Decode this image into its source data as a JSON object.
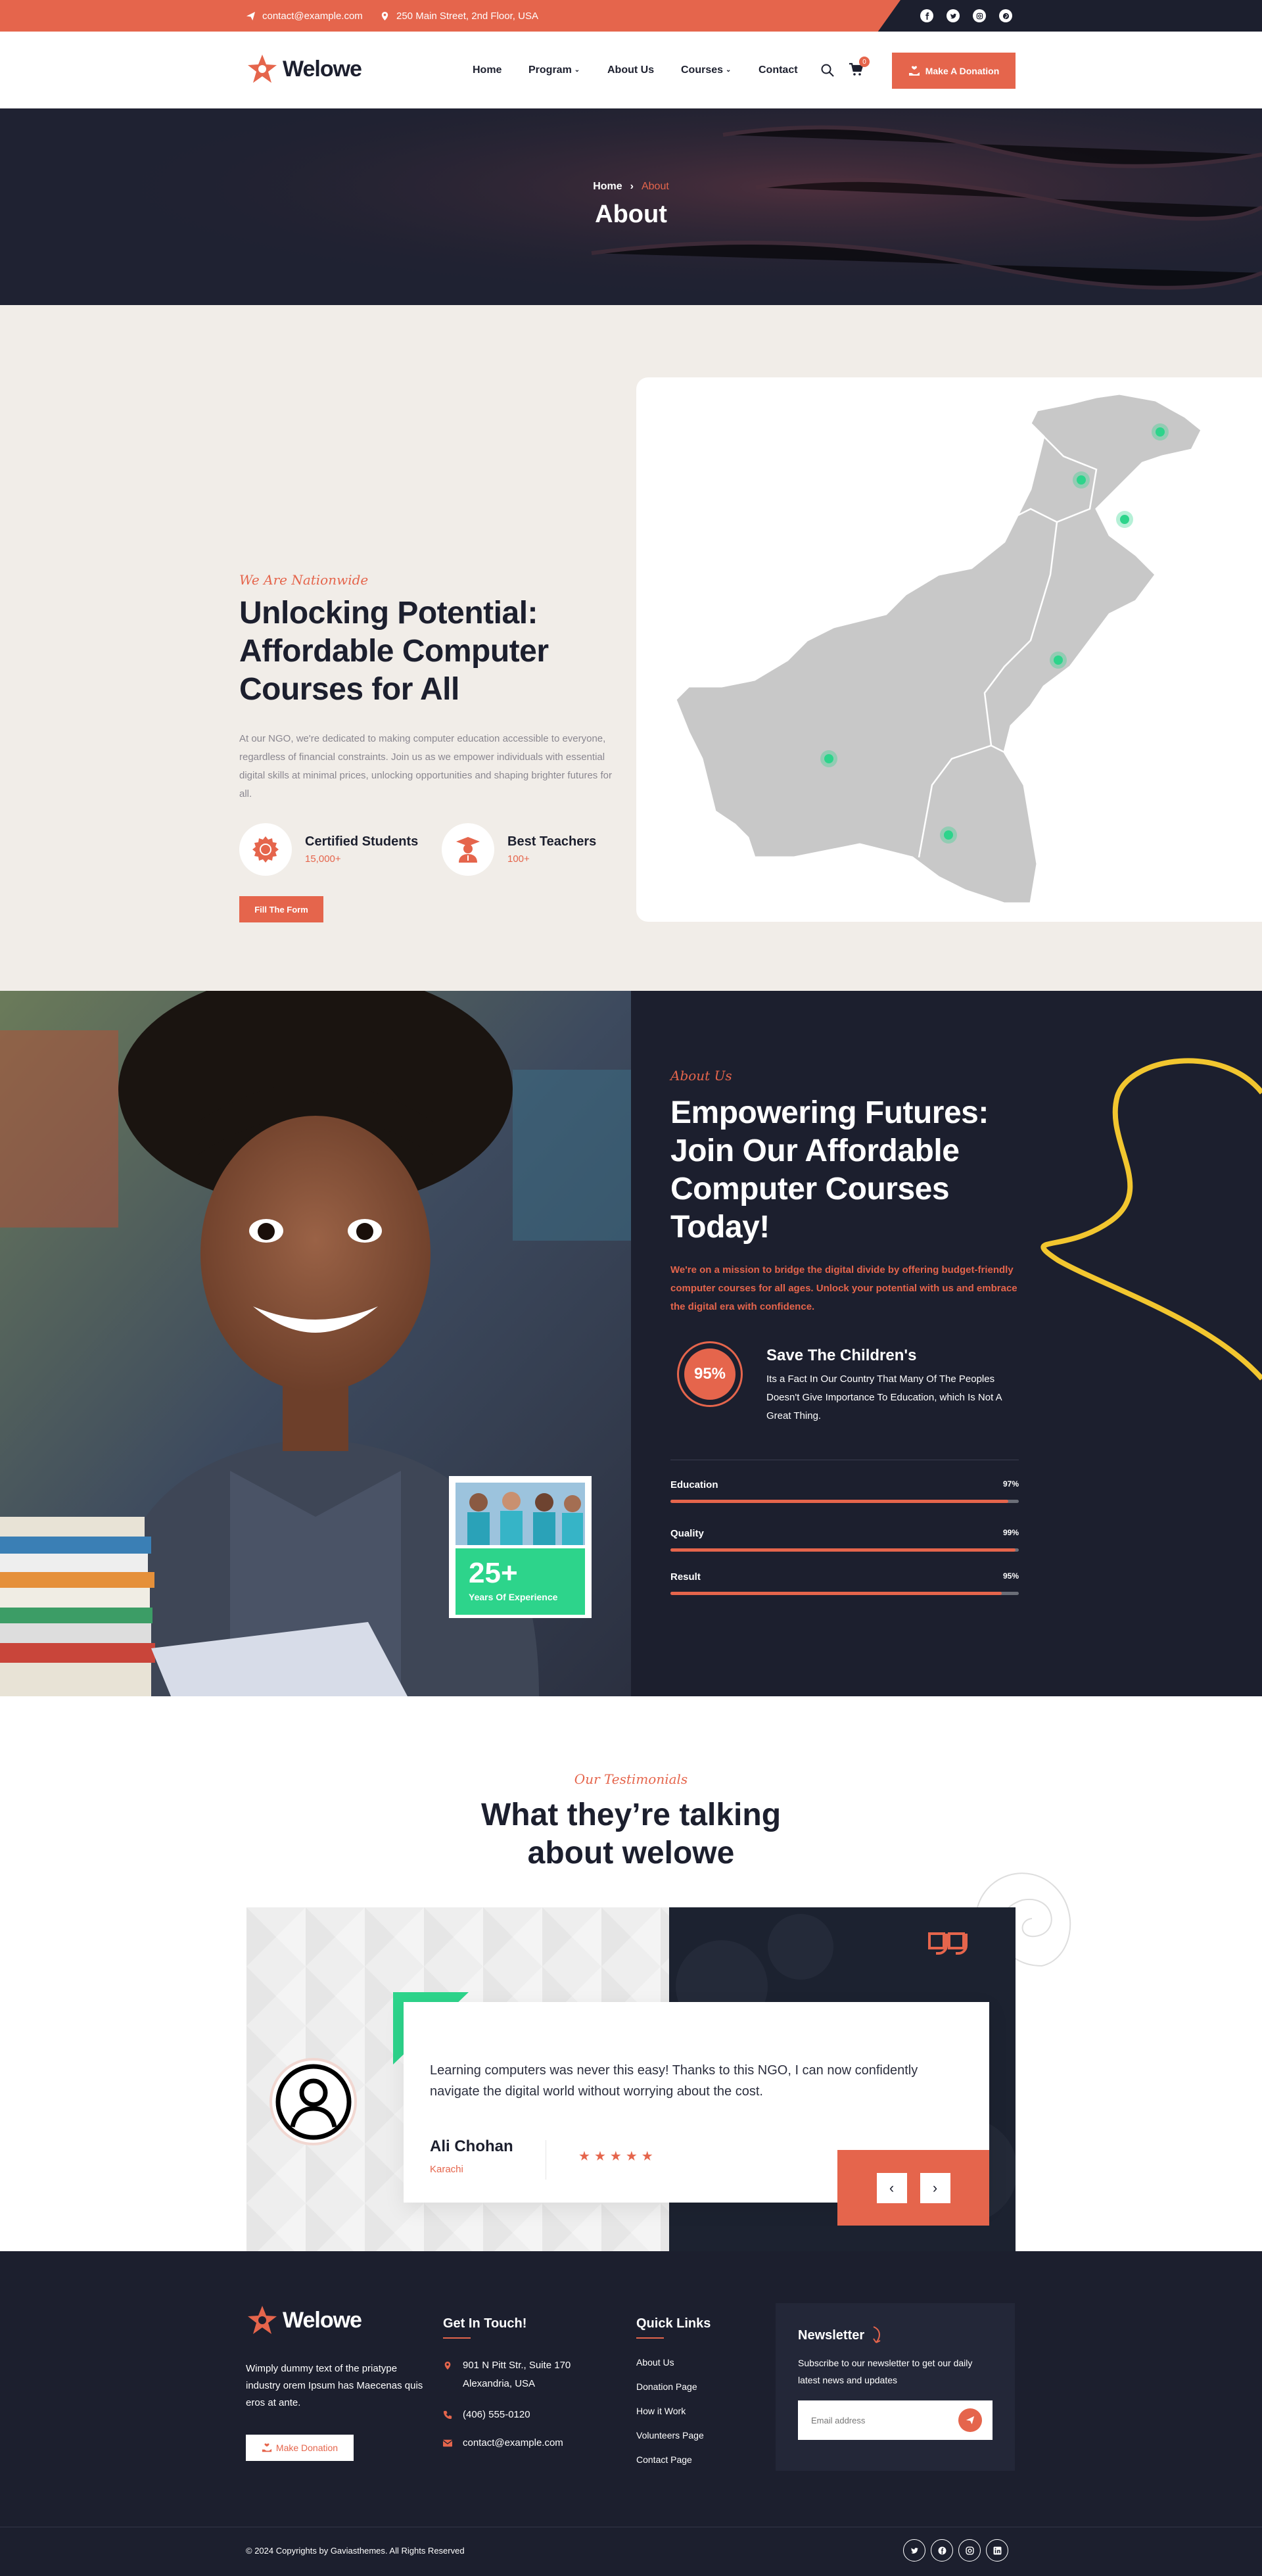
{
  "topbar": {
    "email": "contact@example.com",
    "address": "250 Main Street, 2nd Floor, USA",
    "social": [
      "facebook-icon",
      "twitter-icon",
      "instagram-icon",
      "pinterest-icon"
    ]
  },
  "header": {
    "logo": "Welowe",
    "nav": [
      "Home",
      "Program",
      "About Us",
      "Courses",
      "Contact"
    ],
    "cart_count": "0",
    "donate": "Make A Donation"
  },
  "hero": {
    "breadcrumb_home": "Home",
    "breadcrumb_current": "About",
    "title": "About"
  },
  "intro": {
    "tagline": "We Are Nationwide",
    "title": "Unlocking Potential: Affordable Computer Courses for All",
    "body": "At our NGO, we're dedicated to making computer education accessible to everyone, regardless of financial constraints. Join us as we empower individuals with essential digital skills at minimal prices, unlocking opportunities and shaping brighter futures for all.",
    "stats": [
      {
        "label": "Certified Students",
        "value": "15,000+"
      },
      {
        "label": "Best Teachers",
        "value": "100+"
      }
    ],
    "cta": "Fill The Form"
  },
  "about": {
    "tagline": "About Us",
    "title": "Empowering Futures: Join Our Affordable Computer Courses Today!",
    "lead": "We're on a mission to bridge the digital divide by offering budget-friendly computer courses for all ages. Unlock your potential with us and embrace the digital era with confidence.",
    "circle_value": "95%",
    "circle_title": "Save The Children's",
    "circle_text": "Its a Fact In Our Country That Many Of The Peoples Doesn't Give Importance To Education, which Is Not A Great Thing.",
    "experience_number": "25+",
    "experience_label": "Years Of Experience",
    "bars": [
      {
        "label": "Education",
        "value": "97%",
        "fraction": 0.97
      },
      {
        "label": "Quality",
        "value": "99%",
        "fraction": 0.99
      },
      {
        "label": "Result",
        "value": "95%",
        "fraction": 0.95
      }
    ]
  },
  "testimonials": {
    "tagline": "Our Testimonials",
    "title_line1": "What they’re talking",
    "title_line2": "about welowe",
    "quote": "Learning computers was never this easy! Thanks to this NGO, I can now confidently navigate the digital world without worrying about the cost.",
    "name": "Ali Chohan",
    "city": "Karachi",
    "stars": 5
  },
  "footer": {
    "logo": "Welowe",
    "about": "Wimply dummy text of the priatype industry orem Ipsum has Maecenas quis eros at ante.",
    "donate": "Make Donation",
    "contact_heading": "Get In Touch!",
    "address": "901 N Pitt Str., Suite 170 Alexandria, USA",
    "phone": "(406) 555-0120",
    "email": "contact@example.com",
    "links_heading": "Quick Links",
    "links": [
      "About Us",
      "Donation Page",
      "How it Work",
      "Volunteers Page",
      "Contact Page"
    ],
    "newsletter_heading": "Newsletter",
    "newsletter_text": "Subscribe to our newsletter to get our daily latest news and updates",
    "newsletter_placeholder": "Email address",
    "copyright": "© 2024 Copyrights by Gaviasthemes. All Rights Reserved"
  },
  "colors": {
    "accent": "#e5654c",
    "dark": "#1c1f2e",
    "green": "#2dd48b",
    "beige": "#f1ede8",
    "yellow": "#f2c62f"
  }
}
